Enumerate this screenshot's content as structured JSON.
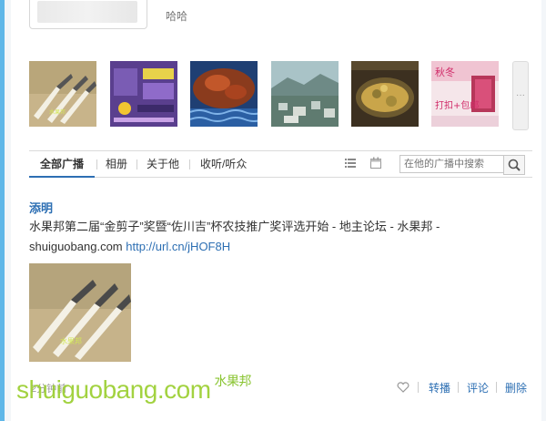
{
  "profile": {
    "hint_text": "哈哈"
  },
  "photos": [
    {
      "name": "pruning-shears"
    },
    {
      "name": "purple-promo"
    },
    {
      "name": "seafood-dish"
    },
    {
      "name": "hillside-town"
    },
    {
      "name": "hotpot"
    },
    {
      "name": "clothing-sale"
    }
  ],
  "tabs": {
    "all": "全部广播",
    "album": "相册",
    "about": "关于他",
    "listen": "收听/听众"
  },
  "search": {
    "placeholder": "在他的广播中搜索"
  },
  "post": {
    "author": "添明",
    "text": "水果邦第二届“金剪子”奖暨“佐川吉”杯农技推广奖评选开始 - 地主论坛 - 水果邦 - shuiguobang.com ",
    "link": "http://url.cn/jHOF8H",
    "time": "2分钟前"
  },
  "actions": {
    "forward": "转播",
    "comment": "评论",
    "delete": "删除"
  },
  "watermark": {
    "text": "shuiguobang.com",
    "small": "水果邦"
  },
  "colors": {
    "accent": "#2d6fb3",
    "left_bar": "#5fb7e8",
    "watermark": "#9bcf30"
  }
}
